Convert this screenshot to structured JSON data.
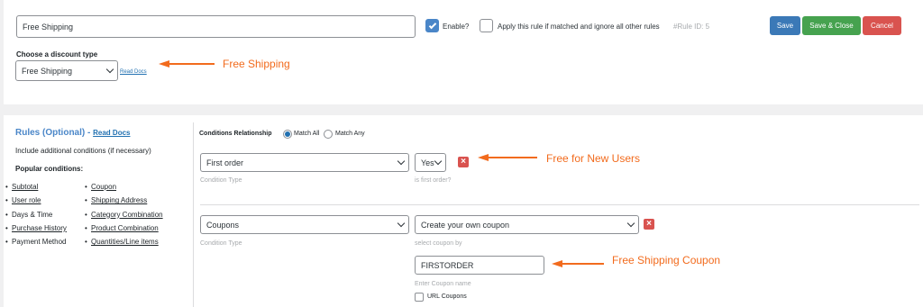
{
  "header": {
    "rule_name_value": "Free Shipping",
    "enable_label": "Enable?",
    "apply_label": "Apply this rule if matched and ignore all other rules",
    "rule_id": "#Rule ID: 5",
    "save_label": "Save",
    "save_close_label": "Save & Close",
    "cancel_label": "Cancel"
  },
  "discount": {
    "heading": "Choose a discount type",
    "selected": "Free Shipping",
    "read_docs": "Read Docs"
  },
  "rules": {
    "heading": "Rules (Optional)",
    "dash": " - ",
    "read_docs": "Read Docs",
    "description": "Include additional conditions (if necessary)",
    "popular_heading": "Popular conditions:",
    "col1": [
      "Subtotal",
      "User role",
      "Days & Time",
      "Purchase History",
      "Payment Method"
    ],
    "col2": [
      "Coupon",
      "Shipping Address",
      "Category Combination",
      "Product Combination",
      "Quantities/Line items"
    ]
  },
  "conditions": {
    "relationship_label": "Conditions Relationship",
    "match_all": "Match All",
    "match_any": "Match Any",
    "cond1_type": "First order",
    "cond1_type_hint": "Condition Type",
    "cond1_value": "Yes",
    "cond1_value_hint": "is first order?",
    "cond2_type": "Coupons",
    "cond2_type_hint": "Condition Type",
    "cond2_value": "Create your own coupon",
    "cond2_value_hint": "select coupon by",
    "coupon_name_value": "FIRSTORDER",
    "coupon_name_hint": "Enter Coupon name",
    "url_coupons_label": "URL Coupons"
  },
  "annotations": {
    "a1": "Free Shipping",
    "a2": "Free for New Users",
    "a3": "Free Shipping Coupon"
  },
  "colors": {
    "accent": "#f26b1d",
    "link": "#2271b1",
    "rules_heading": "#4a86c8"
  }
}
